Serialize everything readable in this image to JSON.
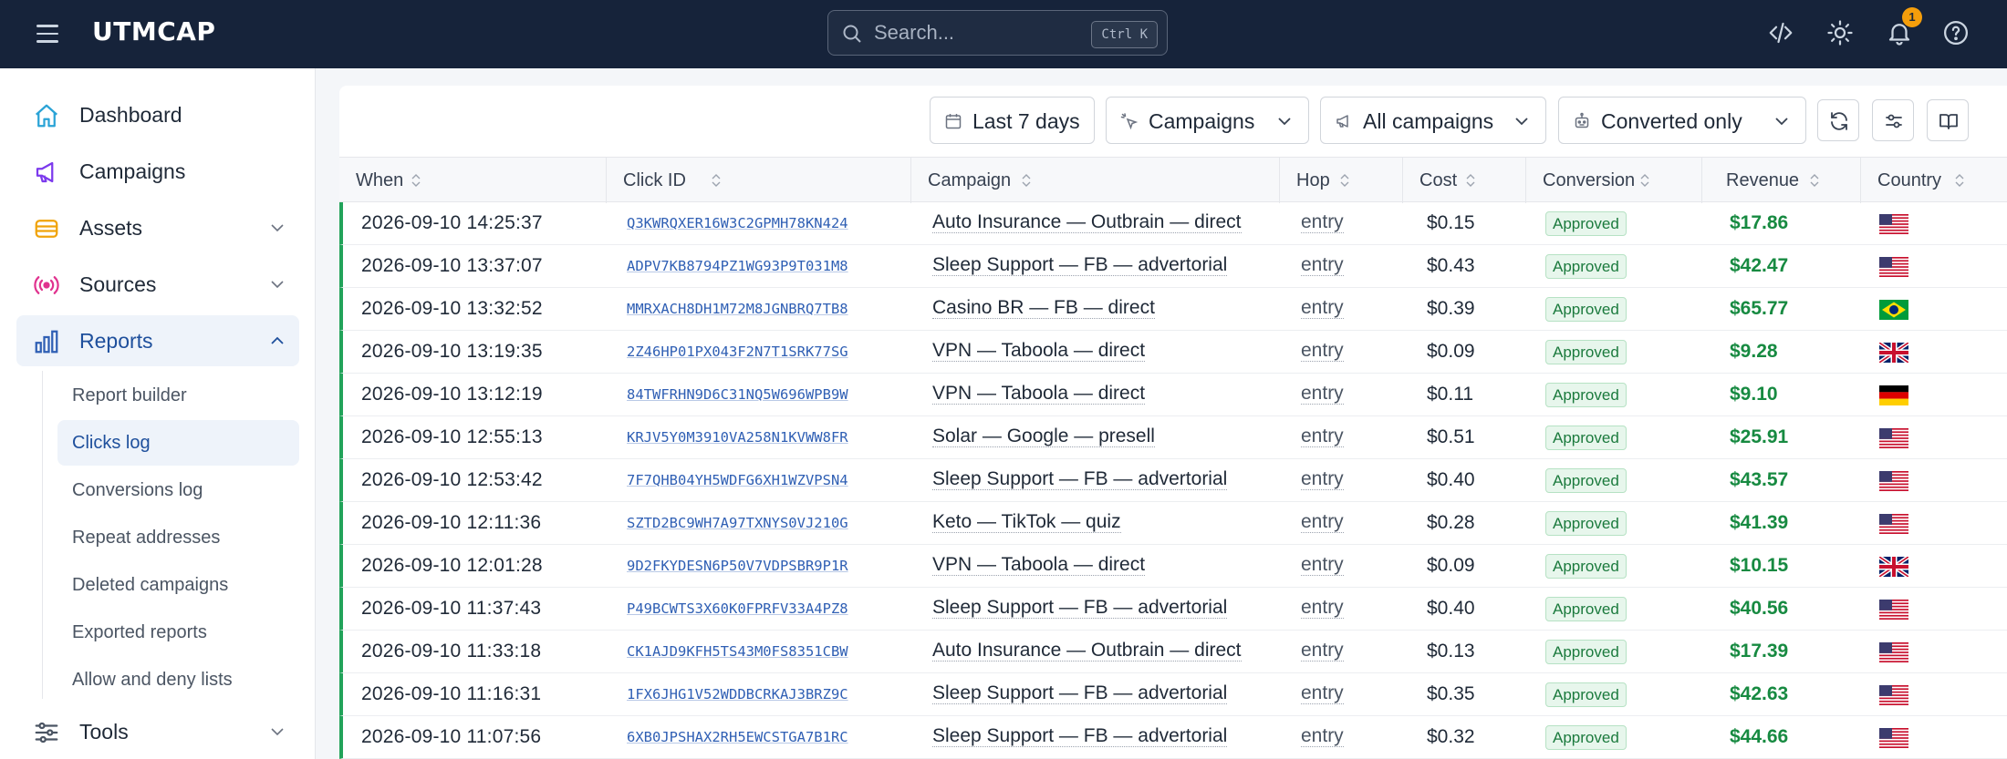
{
  "topbar": {
    "brand": "UTMCAP",
    "search_placeholder": "Search...",
    "search_shortcut": "Ctrl K",
    "notification_count": "1"
  },
  "sidebar": {
    "items": [
      {
        "label": "Dashboard",
        "icon": "home-icon"
      },
      {
        "label": "Campaigns",
        "icon": "megaphone-icon"
      },
      {
        "label": "Assets",
        "icon": "layers-icon"
      },
      {
        "label": "Sources",
        "icon": "broadcast-icon"
      },
      {
        "label": "Reports",
        "icon": "bar-chart-icon"
      },
      {
        "label": "Tools",
        "icon": "sliders-icon"
      }
    ],
    "reports_sub": [
      "Report builder",
      "Clicks log",
      "Conversions log",
      "Repeat addresses",
      "Deleted campaigns",
      "Exported reports",
      "Allow and deny lists"
    ]
  },
  "filters": {
    "date_range": "Last 7 days",
    "group_by": "Campaigns",
    "campaign_filter": "All campaigns",
    "conversion_filter": "Converted only"
  },
  "table": {
    "columns": [
      "When",
      "Click ID",
      "Campaign",
      "Hop",
      "Cost",
      "Conversion",
      "Revenue",
      "Country"
    ],
    "rows": [
      {
        "when": "2026-09-10 14:25:37",
        "click_id": "Q3KWRQXER16W3C2GPMH78KN424",
        "campaign": "Auto Insurance — Outbrain — direct",
        "hop": "entry",
        "cost": "$0.15",
        "conversion": "Approved",
        "revenue": "$17.86",
        "country": "US"
      },
      {
        "when": "2026-09-10 13:37:07",
        "click_id": "ADPV7KB8794PZ1WG93P9T031M8",
        "campaign": "Sleep Support — FB — advertorial",
        "hop": "entry",
        "cost": "$0.43",
        "conversion": "Approved",
        "revenue": "$42.47",
        "country": "US"
      },
      {
        "when": "2026-09-10 13:32:52",
        "click_id": "MMRXACH8DH1M72M8JGNBRQ7TB8",
        "campaign": "Casino BR — FB — direct",
        "hop": "entry",
        "cost": "$0.39",
        "conversion": "Approved",
        "revenue": "$65.77",
        "country": "BR"
      },
      {
        "when": "2026-09-10 13:19:35",
        "click_id": "2Z46HP01PX043F2N7T1SRK77SG",
        "campaign": "VPN — Taboola — direct",
        "hop": "entry",
        "cost": "$0.09",
        "conversion": "Approved",
        "revenue": "$9.28",
        "country": "GB"
      },
      {
        "when": "2026-09-10 13:12:19",
        "click_id": "84TWFRHN9D6C31NQ5W696WPB9W",
        "campaign": "VPN — Taboola — direct",
        "hop": "entry",
        "cost": "$0.11",
        "conversion": "Approved",
        "revenue": "$9.10",
        "country": "DE"
      },
      {
        "when": "2026-09-10 12:55:13",
        "click_id": "KRJV5Y0M3910VA258N1KVWW8FR",
        "campaign": "Solar — Google — presell",
        "hop": "entry",
        "cost": "$0.51",
        "conversion": "Approved",
        "revenue": "$25.91",
        "country": "US"
      },
      {
        "when": "2026-09-10 12:53:42",
        "click_id": "7F7QHB04YH5WDFG6XH1WZVPSN4",
        "campaign": "Sleep Support — FB — advertorial",
        "hop": "entry",
        "cost": "$0.40",
        "conversion": "Approved",
        "revenue": "$43.57",
        "country": "US"
      },
      {
        "when": "2026-09-10 12:11:36",
        "click_id": "SZTD2BC9WH7A97TXNYS0VJ210G",
        "campaign": "Keto — TikTok — quiz",
        "hop": "entry",
        "cost": "$0.28",
        "conversion": "Approved",
        "revenue": "$41.39",
        "country": "US"
      },
      {
        "when": "2026-09-10 12:01:28",
        "click_id": "9D2FKYDESN6P50V7VDPSBR9P1R",
        "campaign": "VPN — Taboola — direct",
        "hop": "entry",
        "cost": "$0.09",
        "conversion": "Approved",
        "revenue": "$10.15",
        "country": "GB"
      },
      {
        "when": "2026-09-10 11:37:43",
        "click_id": "P49BCWTS3X60K0FPRFV33A4PZ8",
        "campaign": "Sleep Support — FB — advertorial",
        "hop": "entry",
        "cost": "$0.40",
        "conversion": "Approved",
        "revenue": "$40.56",
        "country": "US"
      },
      {
        "when": "2026-09-10 11:33:18",
        "click_id": "CK1AJD9KFH5TS43M0FS8351CBW",
        "campaign": "Auto Insurance — Outbrain — direct",
        "hop": "entry",
        "cost": "$0.13",
        "conversion": "Approved",
        "revenue": "$17.39",
        "country": "US"
      },
      {
        "when": "2026-09-10 11:16:31",
        "click_id": "1FX6JHG1V52WDDBCRKAJ3BRZ9C",
        "campaign": "Sleep Support — FB — advertorial",
        "hop": "entry",
        "cost": "$0.35",
        "conversion": "Approved",
        "revenue": "$42.63",
        "country": "US"
      },
      {
        "when": "2026-09-10 11:07:56",
        "click_id": "6XB0JPSHAX2RH5EWCSTGA7B1RC",
        "campaign": "Sleep Support — FB — advertorial",
        "hop": "entry",
        "cost": "$0.32",
        "conversion": "Approved",
        "revenue": "$44.66",
        "country": "US"
      }
    ]
  },
  "colors": {
    "topbar_bg": "#16233a",
    "accent": "#1e4f9c",
    "success": "#178a41",
    "badge": "#f59e0b"
  }
}
